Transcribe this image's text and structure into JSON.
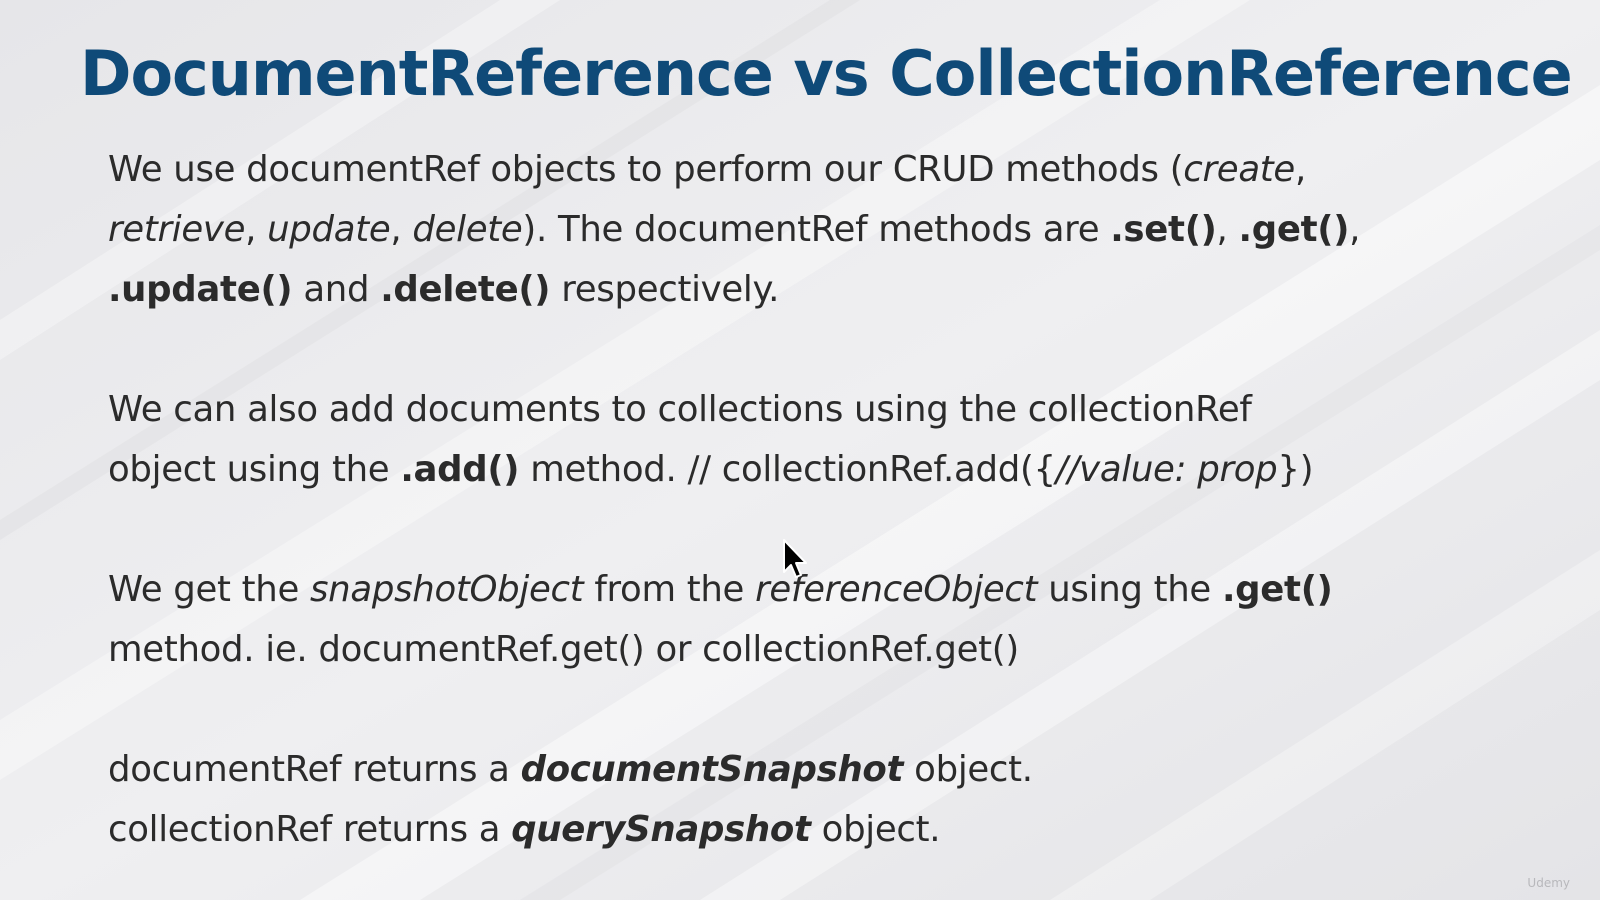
{
  "colors": {
    "title": "#0f4a78",
    "body_text": "#2b2b2b",
    "background": "#ececee"
  },
  "slide": {
    "title": "DocumentReference vs CollectionReference"
  },
  "p1": {
    "l1_a": "We use documentRef objects to perform our CRUD methods (",
    "l1_create": "create",
    "l1_comma": ",",
    "l2_retrieve": "retrieve",
    "l2_c1": ", ",
    "l2_update": "update",
    "l2_c2": ", ",
    "l2_delete": "delete",
    "l2_b": "). The documentRef methods are ",
    "l2_set": ".set()",
    "l2_c3": ", ",
    "l2_get": ".get()",
    "l2_c4": ",",
    "l3_update": ".update()",
    "l3_and": " and ",
    "l3_delete": ".delete()",
    "l3_end": " respectively."
  },
  "p2": {
    "l1": "We can also add documents to collections using the collectionRef",
    "l2_a": "object using the ",
    "l2_add": ".add()",
    "l2_b": " method. // collectionRef.add({",
    "l2_value": "//value: prop",
    "l2_c": "})"
  },
  "p3": {
    "l1_a": "We get the ",
    "l1_snapshot": "snapshotObject",
    "l1_b": " from the ",
    "l1_reference": "referenceObject",
    "l1_c": " using the ",
    "l1_get": ".get()",
    "l2": "method. ie. documentRef.get() or collectionRef.get()"
  },
  "p4": {
    "l1_a": "documentRef returns a ",
    "l1_doc": "documentSnapshot",
    "l1_b": " object.",
    "l2_a": "collectionRef returns a ",
    "l2_query": "querySnapshot",
    "l2_b": " object."
  },
  "watermark": {
    "text": "Udemy"
  }
}
